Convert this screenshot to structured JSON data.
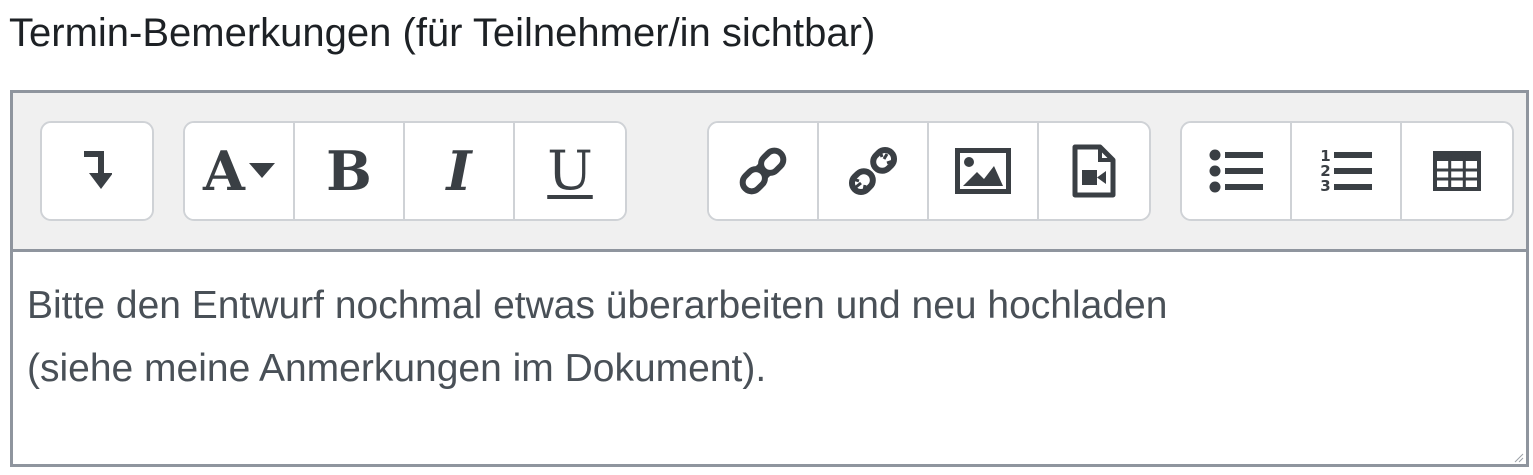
{
  "field": {
    "label": "Termin-Bemerkungen (für Teilnehmer/in sichtbar)"
  },
  "toolbar": {
    "groups": [
      {
        "buttons": [
          {
            "icon": "toggle-toolbar-icon"
          }
        ]
      },
      {
        "buttons": [
          {
            "icon": "font-color-dropdown-icon",
            "glyph": "A"
          },
          {
            "icon": "bold-icon",
            "glyph": "B"
          },
          {
            "icon": "italic-icon",
            "glyph": "I"
          },
          {
            "icon": "underline-icon",
            "glyph": "U"
          }
        ]
      },
      {
        "buttons": [
          {
            "icon": "link-icon"
          },
          {
            "icon": "unlink-icon"
          },
          {
            "icon": "image-icon"
          },
          {
            "icon": "media-file-icon"
          }
        ]
      },
      {
        "buttons": [
          {
            "icon": "bulleted-list-icon"
          },
          {
            "icon": "numbered-list-icon",
            "digits": [
              "1",
              "2",
              "3"
            ]
          },
          {
            "icon": "table-icon"
          }
        ]
      }
    ]
  },
  "editor": {
    "lines": [
      "Bitte den Entwurf nochmal etwas überarbeiten und neu hochladen",
      "(siehe meine Anmerkungen im Dokument)."
    ]
  },
  "colors": {
    "text": "#1d2125",
    "content_text": "#495057",
    "icon": "#3a3f44",
    "toolbar_bg": "#f0f0f0",
    "border": "#8f959e",
    "button_border": "#cfd2d6"
  }
}
